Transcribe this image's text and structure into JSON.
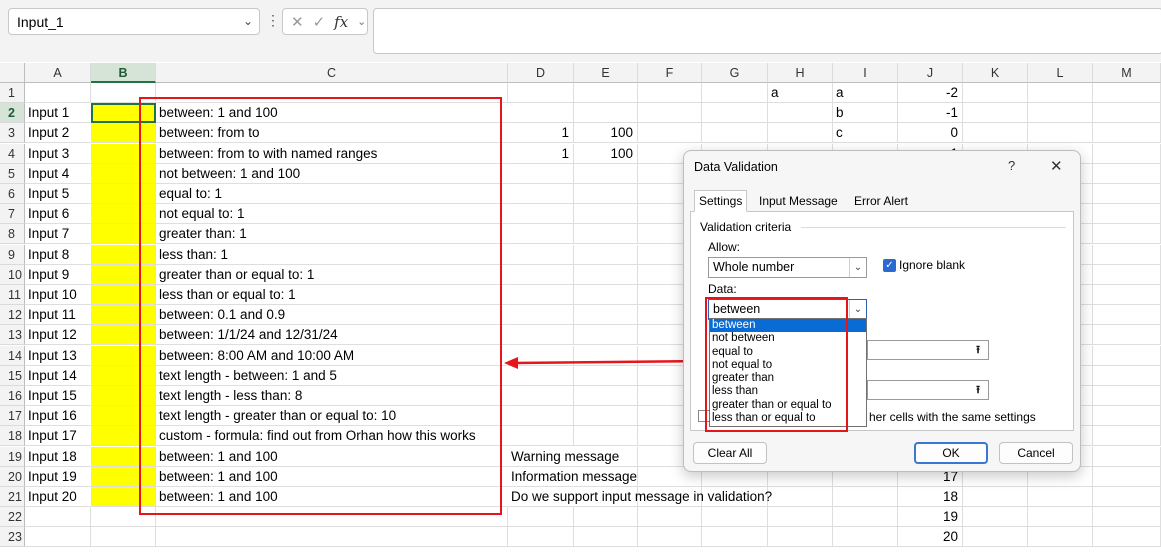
{
  "formula_bar": {
    "name_box": "Input_1",
    "fx_label": "fx",
    "cancel_glyph": "✕",
    "enter_glyph": "✓",
    "formula": ""
  },
  "columns": [
    "A",
    "B",
    "C",
    "D",
    "E",
    "F",
    "G",
    "H",
    "I",
    "J",
    "K",
    "L",
    "M"
  ],
  "rows": [
    "1",
    "2",
    "3",
    "4",
    "5",
    "6",
    "7",
    "8",
    "9",
    "10",
    "11",
    "12",
    "13",
    "14",
    "15",
    "16",
    "17",
    "18",
    "19",
    "20",
    "21",
    "22",
    "23"
  ],
  "cells": {
    "A": [
      "",
      "Input 1",
      "Input 2",
      "Input 3",
      "Input 4",
      "Input 5",
      "Input 6",
      "Input 7",
      "Input 8",
      "Input 9",
      "Input 10",
      "Input 11",
      "Input 12",
      "Input 13",
      "Input 14",
      "Input 15",
      "Input 16",
      "Input 17",
      "Input 18",
      "Input 19",
      "Input 20"
    ],
    "C": [
      "",
      "between: 1 and 100",
      "between: from to",
      "between: from to with named ranges",
      "not between: 1 and 100",
      "equal to: 1",
      "not equal to: 1",
      "greater than: 1",
      "less than: 1",
      "greater than or equal to: 1",
      "less than or equal to: 1",
      "between: 0.1 and 0.9",
      "between: 1/1/24 and 12/31/24",
      "between: 8:00 AM and 10:00 AM",
      "text length - between: 1 and 5",
      "text length - less than: 8",
      "text length - greater than or equal to: 10",
      "custom - formula: find out from Orhan how this works",
      "between: 1 and 100",
      "between: 1 and 100",
      "between: 1 and 100"
    ],
    "D": {
      "3": "1",
      "4": "1",
      "19": "Warning message",
      "20": "Information message",
      "21": "Do we support input message in validation?"
    },
    "E": {
      "3": "100",
      "4": "100"
    },
    "H": {
      "1": "a"
    },
    "I": {
      "1": "a",
      "2": "b",
      "3": "c"
    },
    "J": {
      "1": "-2",
      "2": "-1",
      "3": "0",
      "4": "1",
      "20": "17",
      "21": "18",
      "22": "19",
      "23": "20"
    }
  },
  "dialog": {
    "title": "Data Validation",
    "help": "?",
    "close": "✕",
    "tabs": [
      "Settings",
      "Input Message",
      "Error Alert"
    ],
    "validation_criteria": "Validation criteria",
    "allow_label": "Allow:",
    "allow_value": "Whole number",
    "ignore_blank_label": "Ignore blank",
    "ignore_blank_checked": true,
    "data_label": "Data:",
    "data_value": "between",
    "data_options": [
      "between",
      "not between",
      "equal to",
      "not equal to",
      "greater than",
      "less than",
      "greater than or equal to",
      "less than or equal to"
    ],
    "apply_label_partial": "her cells with the same settings",
    "clear_all": "Clear All",
    "ok": "OK",
    "cancel": "Cancel"
  },
  "colors": {
    "accent_green": "#217346",
    "highlight_yellow": "#ffff00",
    "annotation_red": "#e8141c",
    "selection_blue": "#0a6bd5"
  }
}
